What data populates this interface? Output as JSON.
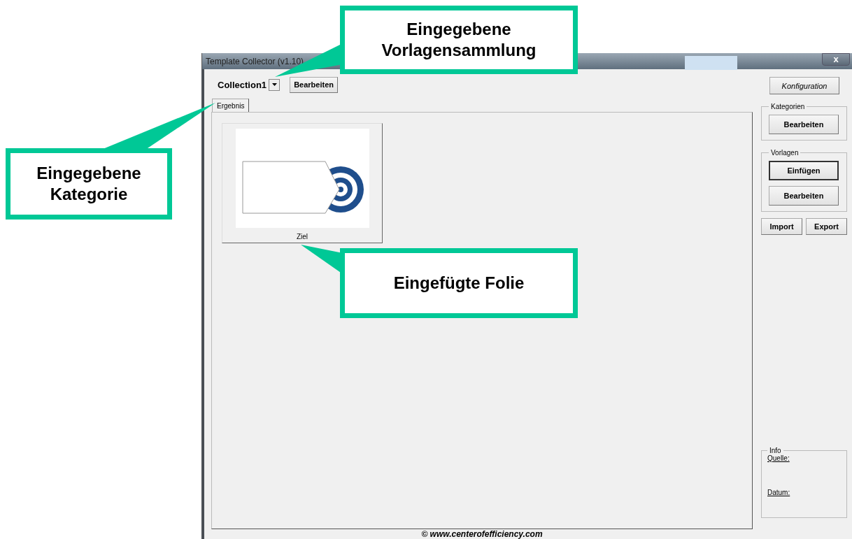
{
  "window": {
    "title": "Template Collector (v1.10)",
    "close": "x"
  },
  "toolbar": {
    "collection": "Collection1",
    "edit_button": "Bearbeiten",
    "config_button": "Konfiguration"
  },
  "tabs": [
    {
      "label": "Ergebnis",
      "selected": true
    }
  ],
  "slides": [
    {
      "label": "Ziel"
    }
  ],
  "groups": [
    {
      "title": "Kategorien",
      "buttons": [
        {
          "label": "Bearbeiten",
          "default": false
        }
      ]
    },
    {
      "title": "Vorlagen",
      "buttons": [
        {
          "label": "Einfügen",
          "default": true
        },
        {
          "label": "Bearbeiten",
          "default": false
        }
      ]
    }
  ],
  "actions": [
    "Import",
    "Export"
  ],
  "info": {
    "title": "Info",
    "fields": [
      "Quelle:",
      "Datum:"
    ]
  },
  "footer": "© www.centerofefficiency.com",
  "callouts": [
    "Eingegebene Vorlagensammlung",
    "Eingegebene Kategorie",
    "Eingefügte Folie"
  ]
}
